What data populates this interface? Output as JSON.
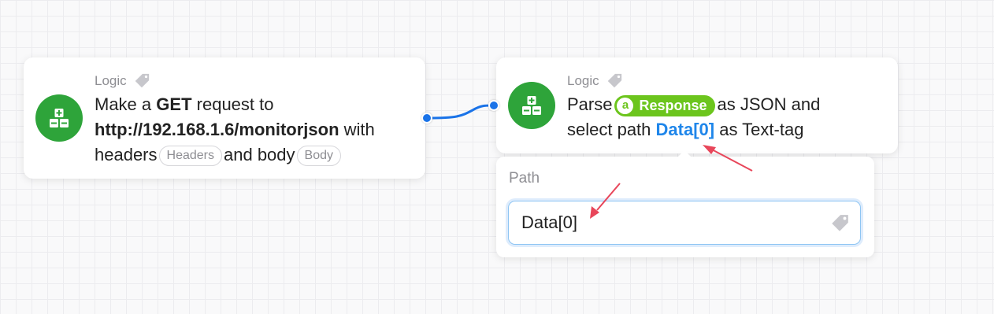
{
  "nodes": [
    {
      "category": "Logic",
      "icon": "blocks-icon",
      "accent": "#2ea43a",
      "text": {
        "line1_prefix": "Make a",
        "method": "GET",
        "line1_suffix": "request to",
        "url": "http://192.168.1.6/monitorjson",
        "url_suffix": "with",
        "line3_prefix": "headers",
        "headers_chip": "Headers",
        "line3_middle": "and body",
        "body_chip": "Body"
      }
    },
    {
      "category": "Logic",
      "icon": "blocks-icon",
      "accent": "#2ea43a",
      "text": {
        "line1_prefix": "Parse",
        "response_badge": "a",
        "response_label": "Response",
        "line1_suffix": "as JSON and",
        "line2_prefix": "select path",
        "path_token": "Data[0]",
        "line2_suffix": "as Text-tag"
      }
    }
  ],
  "path_popup": {
    "label": "Path",
    "value": "Data[0]",
    "tag_icon": "tag-icon"
  },
  "colors": {
    "connector": "#1a73e8",
    "response_chip": "#6cc51d",
    "path_token": "#1f86ea",
    "annotation_arrow": "#e8465a",
    "input_focus_border": "#8ec5f3"
  }
}
